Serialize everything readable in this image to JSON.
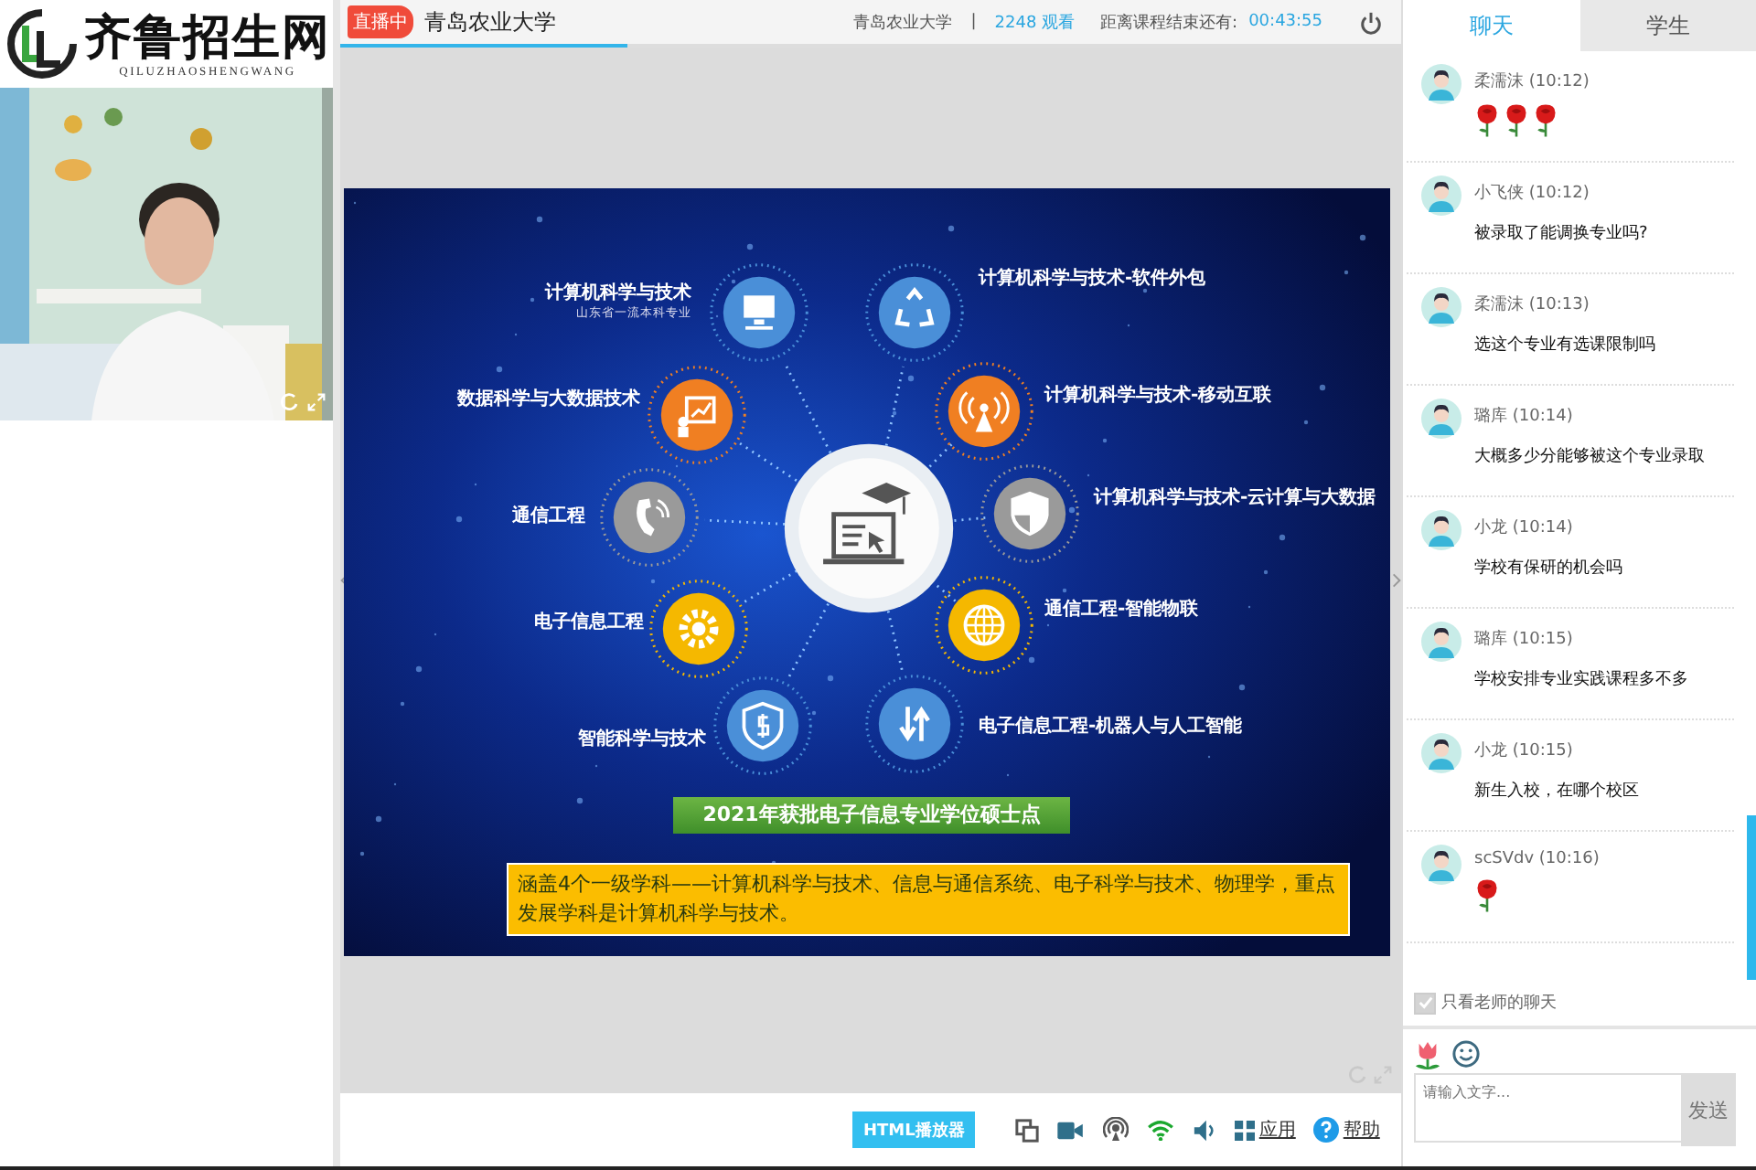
{
  "logo": {
    "title": "齐鲁招生网",
    "subtitle": "QILUZHAOSHENGWANG"
  },
  "header": {
    "live_badge": "直播中",
    "title": "青岛农业大学",
    "school": "青岛农业大学",
    "separator": "|",
    "viewers": "2248 观看",
    "countdown_label": "距离课程结束还有:",
    "countdown": "00:43:55"
  },
  "loading": {
    "level": 0.27
  },
  "slide": {
    "nodes": [
      {
        "label": "计算机科学与技术",
        "note": "山东省一流本科专业",
        "color": "#4a8fd8"
      },
      {
        "label": "数据科学与大数据技术",
        "color": "#f07f22"
      },
      {
        "label": "通信工程",
        "color": "#9a9a9a"
      },
      {
        "label": "电子信息工程",
        "color": "#f5b800"
      },
      {
        "label": "智能科学与技术",
        "color": "#4a8fd8"
      },
      {
        "label": "计算机科学与技术-软件外包",
        "color": "#4a8fd8"
      },
      {
        "label": "计算机科学与技术-移动互联",
        "color": "#f07f22"
      },
      {
        "label": "计算机科学与技术-云计算与大数据",
        "color": "#9a9a9a"
      },
      {
        "label": "通信工程-智能物联",
        "color": "#f5b800"
      },
      {
        "label": "电子信息工程-机器人与人工智能",
        "color": "#4a8fd8"
      }
    ],
    "banner": "2021年获批电子信息专业学位硕士点",
    "summary": "涵盖4个一级学科——计算机科学与技术、信息与通信系统、电子科学与技术、物理学，重点发展学科是计算机科学与技术。"
  },
  "toolbar": {
    "player_button": "HTML播放器",
    "apps": "应用",
    "help": "帮助"
  },
  "chat": {
    "tabs": [
      {
        "label": "聊天",
        "selected": true
      },
      {
        "label": "学生",
        "selected": false
      }
    ],
    "messages": [
      {
        "name": "柔濡沫",
        "time": "(10:12)",
        "kind": "emoji",
        "emojis": [
          {
            "kind": "rose"
          },
          {
            "kind": "rose"
          },
          {
            "kind": "rose"
          }
        ]
      },
      {
        "name": "小飞侠",
        "time": "(10:12)",
        "kind": "text",
        "text": "被录取了能调换专业吗?"
      },
      {
        "name": "柔濡沫",
        "time": "(10:13)",
        "kind": "text",
        "text": "选这个专业有选课限制吗"
      },
      {
        "name": "璐库",
        "time": "(10:14)",
        "kind": "text",
        "text": "大概多少分能够被这个专业录取"
      },
      {
        "name": "小龙",
        "time": "(10:14)",
        "kind": "text",
        "text": "学校有保研的机会吗"
      },
      {
        "name": "璐库",
        "time": "(10:15)",
        "kind": "text",
        "text": "学校安排专业实践课程多不多"
      },
      {
        "name": "小龙",
        "time": "(10:15)",
        "kind": "text",
        "text": "新生入校，在哪个校区"
      },
      {
        "name": "scSVdv",
        "time": "(10:16)",
        "kind": "emoji",
        "emojis": [
          {
            "kind": "rose"
          }
        ]
      }
    ],
    "teacher_only": {
      "label": "只看老师的聊天",
      "checked": true
    },
    "input": {
      "placeholder": "请输入文字..."
    },
    "send": "发送"
  }
}
